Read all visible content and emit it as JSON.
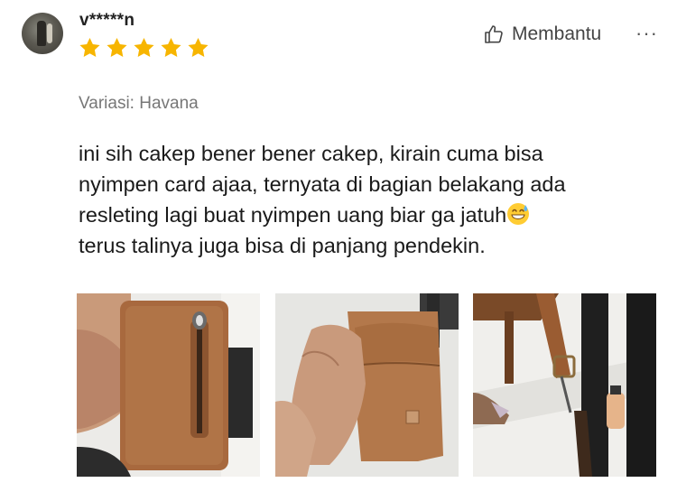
{
  "review": {
    "username": "v*****n",
    "rating": 5,
    "rating_max": 5,
    "helpful_label": "Membantu",
    "more_label": "···",
    "variant": "Variasi: Havana",
    "text_line1": "ini sih cakep bener bener cakep, kirain cuma bisa",
    "text_line2": "nyimpen card ajaa, ternyata di bagian belakang ada",
    "text_line3": "resleting lagi buat nyimpen uang biar ga jatuh",
    "text_line4": "terus talinya juga bisa di panjang pendekin.",
    "emoji": "grinning-face-with-sweat"
  },
  "photos": [
    {
      "subject": "brown leather phone pouch with zipper"
    },
    {
      "subject": "back of brown leather pouch with card slot"
    },
    {
      "subject": "brown leather strap with buckle"
    }
  ],
  "colors": {
    "star": "#f7b500",
    "leather": "#a0643a",
    "text_primary": "#1a1a1a",
    "text_secondary": "#777777"
  },
  "icons": {
    "helpful": "thumbs-up-icon",
    "more": "more-options-icon"
  }
}
